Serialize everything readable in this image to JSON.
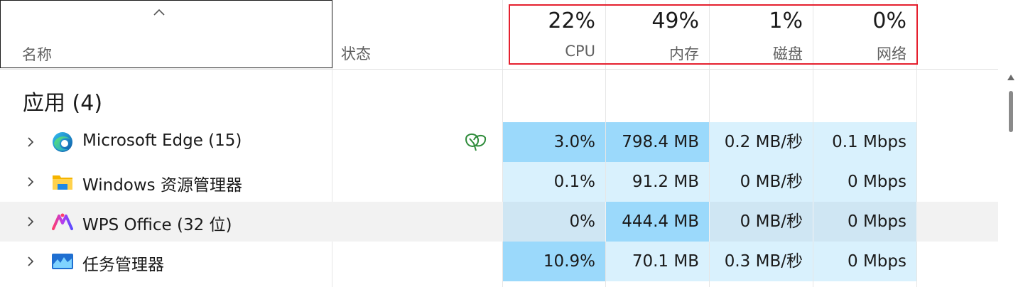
{
  "columns": {
    "name_label": "名称",
    "status_label": "状态",
    "cpu": {
      "percent": "22%",
      "label": "CPU"
    },
    "memory": {
      "percent": "49%",
      "label": "内存"
    },
    "disk": {
      "percent": "1%",
      "label": "磁盘"
    },
    "network": {
      "percent": "0%",
      "label": "网络"
    }
  },
  "group": {
    "title": "应用 (4)"
  },
  "processes": [
    {
      "name": "Microsoft Edge (15)",
      "icon": "edge-icon",
      "efficiency_mode": true,
      "cpu": "3.0%",
      "memory": "798.4 MB",
      "disk": "0.2 MB/秒",
      "network": "0.1 Mbps"
    },
    {
      "name": "Windows 资源管理器",
      "icon": "file-explorer-icon",
      "efficiency_mode": false,
      "cpu": "0.1%",
      "memory": "91.2 MB",
      "disk": "0 MB/秒",
      "network": "0 Mbps"
    },
    {
      "name": "WPS Office (32 位)",
      "icon": "wps-office-icon",
      "efficiency_mode": false,
      "cpu": "0%",
      "memory": "444.4 MB",
      "disk": "0 MB/秒",
      "network": "0 Mbps"
    },
    {
      "name": "任务管理器",
      "icon": "task-manager-icon",
      "efficiency_mode": false,
      "cpu": "10.9%",
      "memory": "70.1 MB",
      "disk": "0.3 MB/秒",
      "network": "0 Mbps"
    }
  ],
  "colors": {
    "highlight_box": "#e5202e",
    "heat_dark": "#9bd9fb",
    "heat_mid": "#bfe6fc",
    "heat_light": "#d9f1fd",
    "efficiency_leaf": "#2e8b3a"
  }
}
